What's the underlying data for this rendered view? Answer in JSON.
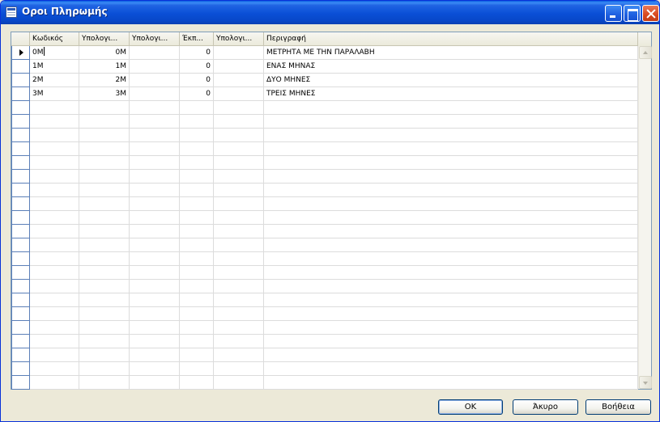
{
  "window": {
    "title": "Οροι Πληρωμής"
  },
  "grid": {
    "columns": [
      {
        "label": "Κωδικός"
      },
      {
        "label": "Υπολογι..."
      },
      {
        "label": "Υπολογι..."
      },
      {
        "label": "Έκπ..."
      },
      {
        "label": "Υπολογι..."
      },
      {
        "label": "Περιγραφή"
      }
    ],
    "rows": [
      {
        "code": "0M",
        "calc1": "0M",
        "calc2": "",
        "disc": "0",
        "calc3": "",
        "desc": "ΜΕΤΡΗΤΑ ΜΕ ΤΗΝ ΠΑΡΑΛΑΒΗ"
      },
      {
        "code": "1M",
        "calc1": "1M",
        "calc2": "",
        "disc": "0",
        "calc3": "",
        "desc": "ΕΝΑΣ ΜΗΝΑΣ"
      },
      {
        "code": "2M",
        "calc1": "2M",
        "calc2": "",
        "disc": "0",
        "calc3": "",
        "desc": "ΔΥΟ ΜΗΝΕΣ"
      },
      {
        "code": "3M",
        "calc1": "3M",
        "calc2": "",
        "disc": "0",
        "calc3": "",
        "desc": "ΤΡΕΙΣ ΜΗΝΕΣ"
      }
    ],
    "current_row": 0
  },
  "buttons": {
    "ok": "OK",
    "cancel": "Άκυρο",
    "help": "Βοήθεια"
  }
}
